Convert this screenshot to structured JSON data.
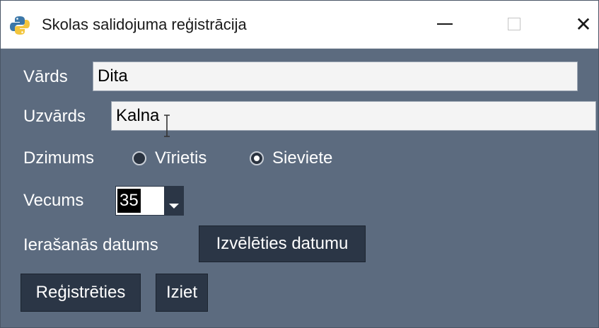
{
  "window": {
    "title": "Skolas salidojuma reģistrācija",
    "app_icon": "python-icon",
    "controls": {
      "minimize": "minimize-icon",
      "maximize": "maximize-icon",
      "close": "✕"
    }
  },
  "form": {
    "first_name": {
      "label": "Vārds",
      "value": "Dita"
    },
    "last_name": {
      "label": "Uzvārds",
      "value": "Kalna"
    },
    "gender": {
      "label": "Dzimums",
      "options": [
        {
          "label": "Vīrietis",
          "checked": false
        },
        {
          "label": "Sieviete",
          "checked": true
        }
      ]
    },
    "age": {
      "label": "Vecums",
      "value": "35"
    },
    "arrival_date": {
      "label": "Ierašanās datums",
      "button_label": "Izvēlēties datumu"
    }
  },
  "actions": {
    "register_label": "Reģistrēties",
    "exit_label": "Iziet"
  },
  "colors": {
    "window_bg": "#5c6b7f",
    "button_bg": "#2b3646",
    "entry_bg": "#f4f4f4"
  }
}
